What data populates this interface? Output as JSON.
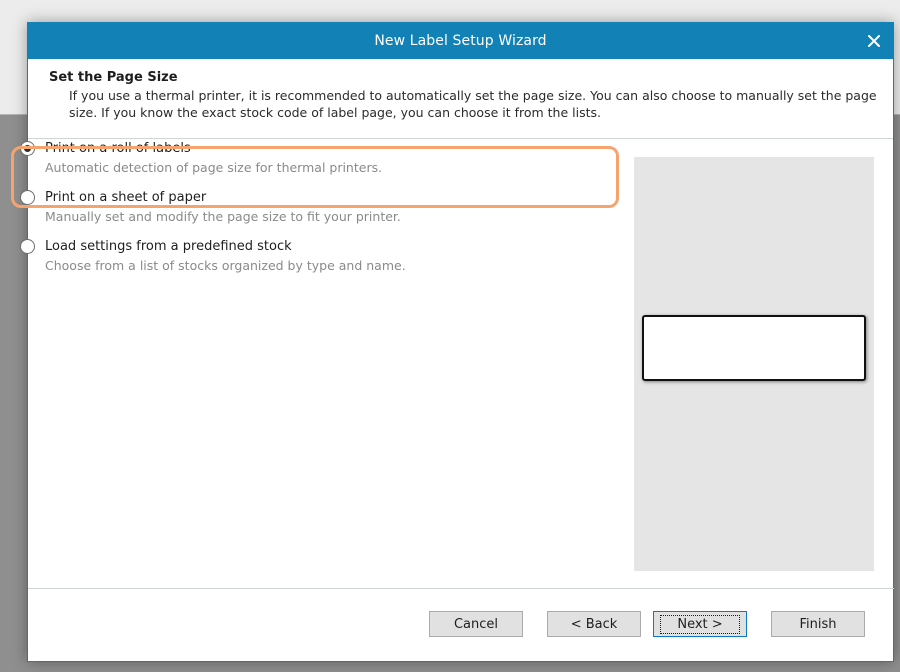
{
  "dialog": {
    "title": "New Label Setup Wizard"
  },
  "header": {
    "title": "Set the Page Size",
    "description": "If you use a thermal printer, it is recommended to automatically set the page size. You can also choose to manually set the page size. If you know the exact stock code of label page, you can choose it from the lists."
  },
  "options": [
    {
      "label": "Print on a roll of labels",
      "description": "Automatic detection of page size for thermal printers.",
      "checked": true
    },
    {
      "label": "Print on a sheet of paper",
      "description": "Manually set and modify the page size to fit your printer.",
      "checked": false
    },
    {
      "label": "Load settings from a predefined stock",
      "description": "Choose from a list of stocks organized by type and name.",
      "checked": false
    }
  ],
  "buttons": {
    "cancel": "Cancel",
    "back": "< Back",
    "next": "Next >",
    "finish": "Finish"
  },
  "colors": {
    "titlebar": "#1281b6",
    "highlight": "#f6a46f",
    "preview_bg": "#e5e5e5"
  },
  "icons": {
    "close": "close-icon"
  }
}
